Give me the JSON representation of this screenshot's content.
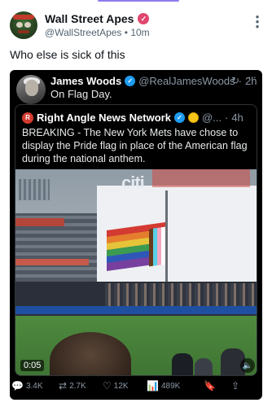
{
  "post": {
    "author_name": "Wall Street Apes",
    "author_handle": "@WallStreetApes",
    "time": "10m",
    "separator": "•",
    "text": "Who else is sick of this"
  },
  "quote": {
    "author_name": "James Woods",
    "author_handle": "@RealJamesWoods",
    "separator": "·",
    "time": "2h",
    "text": "On Flag Day.",
    "inner": {
      "author_name": "Right Angle News Network",
      "author_handle": "@...",
      "separator": "·",
      "time": "4h",
      "text": "BREAKING - The New York Mets have chose to display the Pride flag in place of the American flag during the national anthem.",
      "video": {
        "duration": "0:05",
        "board_text": "citi"
      }
    },
    "actions": {
      "replies": "3.4K",
      "reposts": "2.7K",
      "likes": "12K",
      "views": "489K"
    }
  },
  "colors": {
    "verified_pink": "#e0466e",
    "verified_blue": "#1d9bf0",
    "verified_gold": "#f5c518",
    "card_bg": "#000000"
  },
  "icons": [
    "more-icon",
    "refresh-icon",
    "reply-icon",
    "repost-icon",
    "like-icon",
    "views-icon",
    "bookmark-icon",
    "share-icon",
    "mute-icon"
  ]
}
